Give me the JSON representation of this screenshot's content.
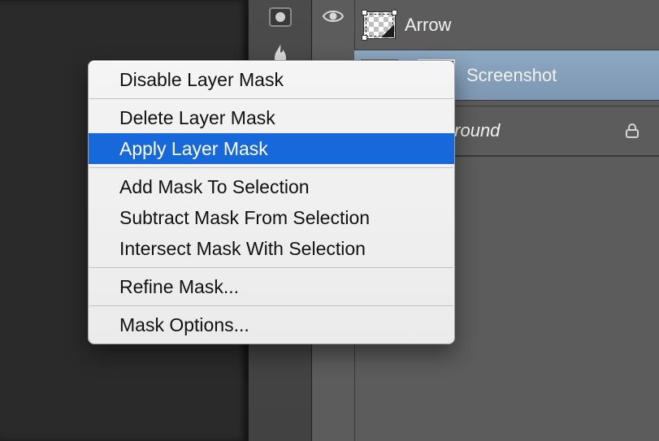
{
  "layers": {
    "items": [
      {
        "name": "Arrow",
        "selected": false,
        "locked": false,
        "visible": true,
        "has_mask": false
      },
      {
        "name": "Screenshot",
        "selected": true,
        "locked": false,
        "visible": true,
        "has_mask": true
      },
      {
        "name": "Background",
        "selected": false,
        "locked": true,
        "visible": true,
        "has_mask": false
      }
    ]
  },
  "context_menu": {
    "selected_index": 2,
    "items": [
      {
        "label": "Disable Layer Mask",
        "sep_after": true
      },
      {
        "label": "Delete Layer Mask"
      },
      {
        "label": "Apply Layer Mask",
        "sep_after": true
      },
      {
        "label": "Add Mask To Selection"
      },
      {
        "label": "Subtract Mask From Selection"
      },
      {
        "label": "Intersect Mask With Selection",
        "sep_after": true
      },
      {
        "label": "Refine Mask...",
        "sep_after": true
      },
      {
        "label": "Mask Options..."
      }
    ]
  },
  "icons": {
    "eye": "visibility-eye-icon",
    "lock": "lock-icon",
    "tool_a": "mask-tool-icon",
    "tool_b": "flame-tool-icon"
  }
}
